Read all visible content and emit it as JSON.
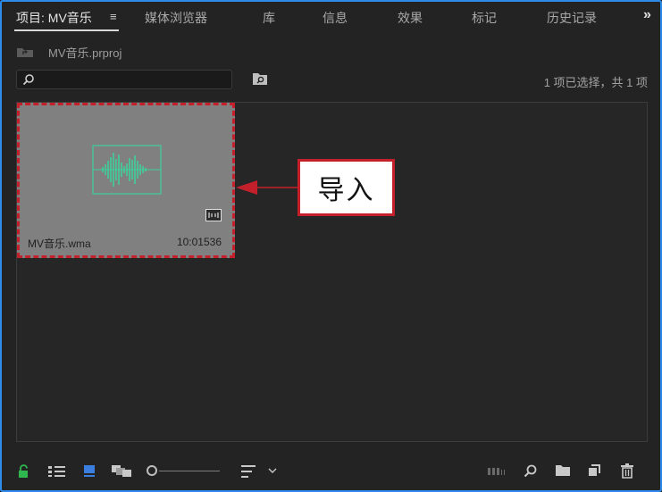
{
  "tabs": [
    {
      "label": "项目: MV音乐",
      "active": true
    },
    {
      "label": "媒体浏览器"
    },
    {
      "label": "库"
    },
    {
      "label": "信息"
    },
    {
      "label": "效果"
    },
    {
      "label": "标记"
    },
    {
      "label": "历史记录"
    }
  ],
  "tab_menu_glyph": "≡",
  "overflow_glyph": "»",
  "project_path": "MV音乐.prproj",
  "search": {
    "value": "",
    "placeholder": ""
  },
  "selection_status": "1 项已选择，共 1 项",
  "clip": {
    "name": "MV音乐.wma",
    "duration": "10:01536"
  },
  "callout": {
    "label": "导入"
  },
  "colors": {
    "accent": "#2d8ceb",
    "annotation_red": "#c4202c",
    "waveform": "#3ecf9a"
  },
  "toolbar": {
    "icons": [
      "lock-icon",
      "list-view-icon",
      "icon-view-icon",
      "freeform-view-icon",
      "zoom-slider",
      "sort-icon",
      "automate-sequence-icon",
      "find-icon",
      "new-bin-icon",
      "new-item-icon",
      "trash-icon"
    ]
  }
}
